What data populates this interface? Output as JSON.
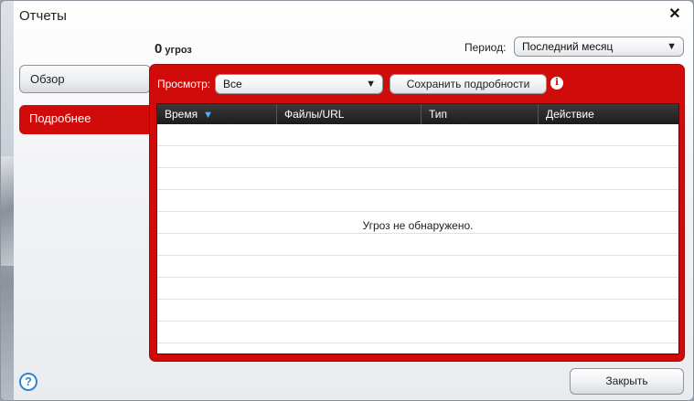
{
  "window": {
    "title": "Отчеты",
    "close_icon": "close-icon"
  },
  "summary": {
    "threat_count": "0",
    "threat_unit": "угроз"
  },
  "period": {
    "label": "Период:",
    "selected": "Последний месяц"
  },
  "nav": {
    "items": [
      {
        "label": "Обзор",
        "active": false
      },
      {
        "label": "Подробнее",
        "active": true
      }
    ]
  },
  "details": {
    "view_label": "Просмотр:",
    "view_selected": "Все",
    "save_button": "Сохранить подробности",
    "info_icon": "info-icon",
    "table": {
      "columns": [
        "Время",
        "Файлы/URL",
        "Тип",
        "Действие"
      ],
      "sorted_by": "Время",
      "sort_direction": "descending",
      "rows": [],
      "empty_message": "Угроз не обнаружено."
    }
  },
  "footer": {
    "help_icon": "help-icon",
    "close_button": "Закрыть"
  },
  "colors": {
    "accent_red": "#d10a0a",
    "table_header": "#1c1c1c",
    "sort_arrow": "#4fb3ff",
    "help_blue": "#2c86d8"
  }
}
